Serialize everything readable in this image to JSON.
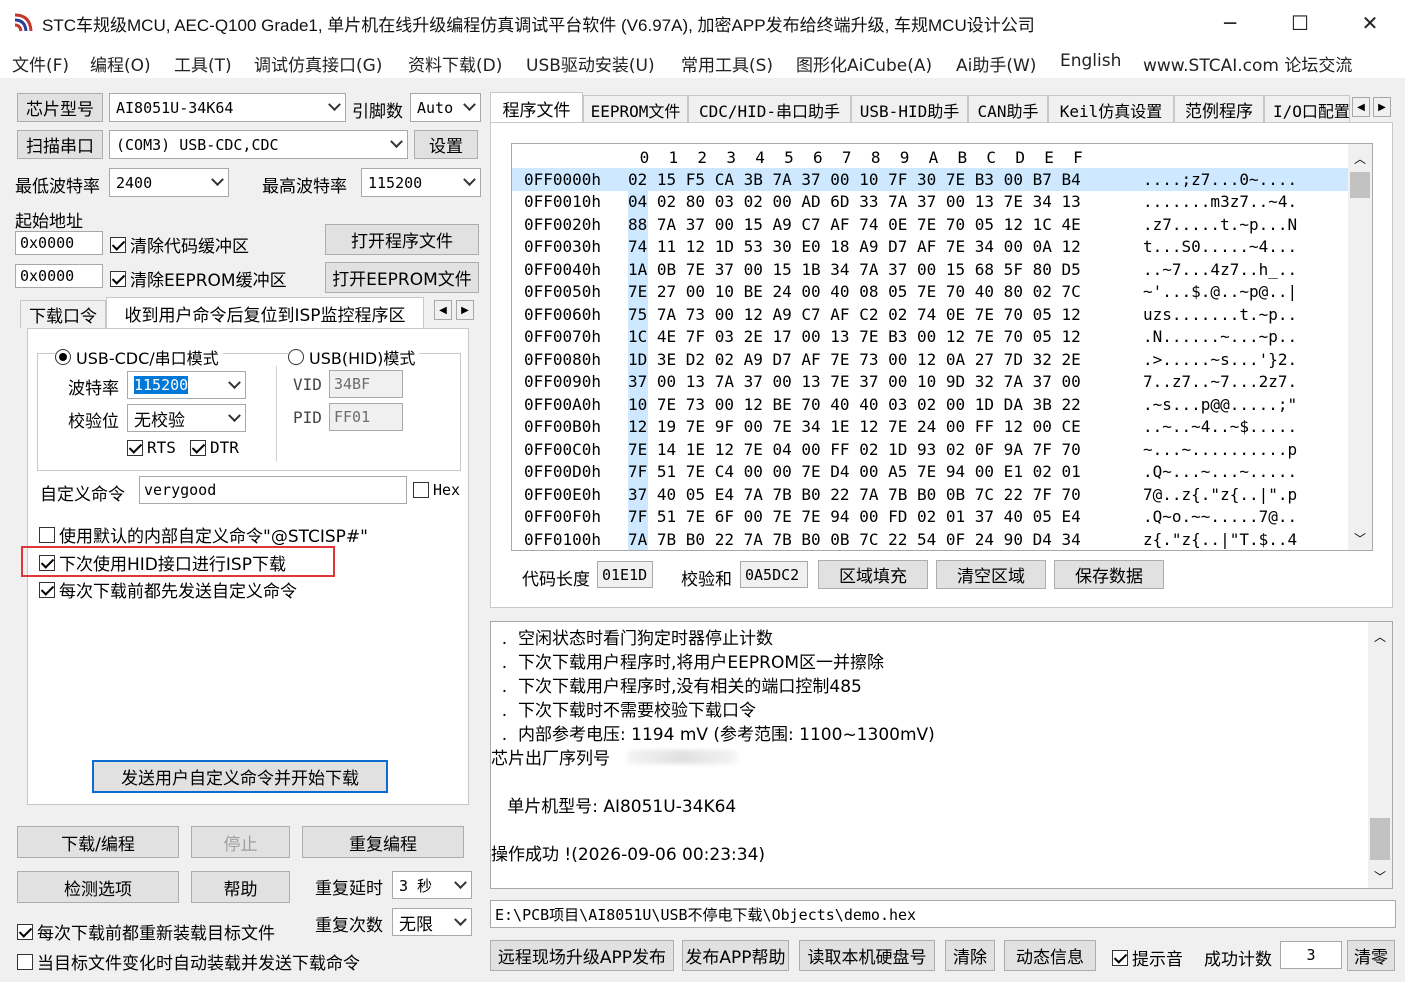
{
  "window": {
    "title": "STC车规级MCU, AEC-Q100 Grade1, 单片机在线升级编程仿真调试平台软件 (V6.97A), 加密APP发布给终端升级, 车规MCU设计公司",
    "minimize": "─",
    "maximize": "☐",
    "close": "✕"
  },
  "menu": [
    "文件(F)",
    "编程(O)",
    "工具(T)",
    "调试仿真接口(G)",
    "资料下载(D)",
    "USB驱动安装(U)",
    "常用工具(S)",
    "图形化AiCube(A)",
    "Ai助手(W)",
    "English",
    "www.STCAI.com 论坛交流"
  ],
  "left": {
    "chip_button": "芯片型号",
    "chip_value": "AI8051U-34K64",
    "pins_label": "引脚数",
    "pins_value": "Auto",
    "scan_button": "扫描串口",
    "port_value": "(COM3) USB-CDC,CDC",
    "settings_button": "设置",
    "min_baud_label": "最低波特率",
    "min_baud_value": "2400",
    "max_baud_label": "最高波特率",
    "max_baud_value": "115200",
    "start_addr_label": "起始地址",
    "code_addr": "0x0000",
    "clear_code_label": "清除代码缓冲区",
    "open_program_button": "打开程序文件",
    "eeprom_addr": "0x0000",
    "clear_eeprom_label": "清除EEPROM缓冲区",
    "open_eeprom_button": "打开EEPROM文件",
    "subtabs": [
      "下载口令",
      "收到用户命令后复位到ISP监控程序区"
    ],
    "cdc_mode_label": "USB-CDC/串口模式",
    "hid_mode_label": "USB(HID)模式",
    "baud_label": "波特率",
    "baud_value": "115200",
    "parity_label": "校验位",
    "parity_value": "无校验",
    "rts_label": "RTS",
    "dtr_label": "DTR",
    "vid_label": "VID",
    "vid_value": "34BF",
    "pid_label": "PID",
    "pid_value": "FF01",
    "custom_cmd_label": "自定义命令",
    "custom_cmd_value": "verygood",
    "hex_label": "Hex",
    "default_cmd_label": "使用默认的内部自定义命令\"@STCISP#\"",
    "next_hid_label": "下次使用HID接口进行ISP下载",
    "send_before_label": "每次下载前都先发送自定义命令",
    "send_start_button": "发送用户自定义命令并开始下载",
    "download_button": "下载/编程",
    "stop_button": "停止",
    "reprogram_button": "重复编程",
    "options_button": "检测选项",
    "help_button": "帮助",
    "repeat_delay_label": "重复延时",
    "repeat_delay_value": "3 秒",
    "repeat_count_label": "重复次数",
    "repeat_count_value": "无限",
    "reload_label": "每次下载前都重新装载目标文件",
    "auto_load_label": "当目标文件变化时自动装载并发送下载命令"
  },
  "right": {
    "tabs": [
      "程序文件",
      "EEPROM文件",
      "CDC/HID-串口助手",
      "USB-HID助手",
      "CAN助手",
      "Keil仿真设置",
      "范例程序",
      "I/O口配置"
    ],
    "hex_header": [
      "0",
      "1",
      "2",
      "3",
      "4",
      "5",
      "6",
      "7",
      "8",
      "9",
      "A",
      "B",
      "C",
      "D",
      "E",
      "F"
    ],
    "hex_rows": [
      {
        "addr": "0FF0000h",
        "bytes": "02 15 F5 CA 3B 7A 37 00 10 7F 30 7E B3 00 B7 B4",
        "ascii": "....;z7...0~...."
      },
      {
        "addr": "0FF0010h",
        "bytes": "04 02 80 03 02 00 AD 6D 33 7A 37 00 13 7E 34 13",
        "ascii": ".......m3z7..~4."
      },
      {
        "addr": "0FF0020h",
        "bytes": "88 7A 37 00 15 A9 C7 AF 74 0E 7E 70 05 12 1C 4E",
        "ascii": ".z7.....t.~p...N"
      },
      {
        "addr": "0FF0030h",
        "bytes": "74 11 12 1D 53 30 E0 18 A9 D7 AF 7E 34 00 0A 12",
        "ascii": "t...S0.....~4..."
      },
      {
        "addr": "0FF0040h",
        "bytes": "1A 0B 7E 37 00 15 1B 34 7A 37 00 15 68 5F 80 D5",
        "ascii": "..~7...4z7..h_.."
      },
      {
        "addr": "0FF0050h",
        "bytes": "7E 27 00 10 BE 24 00 40 08 05 7E 70 40 80 02 7C",
        "ascii": "~'...$.@..~p@..|"
      },
      {
        "addr": "0FF0060h",
        "bytes": "75 7A 73 00 12 A9 C7 AF C2 02 74 0E 7E 70 05 12",
        "ascii": "uzs.......t.~p.."
      },
      {
        "addr": "0FF0070h",
        "bytes": "1C 4E 7F 03 2E 17 00 13 7E B3 00 12 7E 70 05 12",
        "ascii": ".N......~...~p.."
      },
      {
        "addr": "0FF0080h",
        "bytes": "1D 3E D2 02 A9 D7 AF 7E 73 00 12 0A 27 7D 32 2E",
        "ascii": ".>.....~s...'}2."
      },
      {
        "addr": "0FF0090h",
        "bytes": "37 00 13 7A 37 00 13 7E 37 00 10 9D 32 7A 37 00",
        "ascii": "7..z7..~7...2z7."
      },
      {
        "addr": "0FF00A0h",
        "bytes": "10 7E 73 00 12 BE 70 40 40 03 02 00 1D DA 3B 22",
        "ascii": ".~s...p@@.....;\""
      },
      {
        "addr": "0FF00B0h",
        "bytes": "12 19 7E 9F 00 7E 34 1E 12 7E 24 00 FF 12 00 CE",
        "ascii": "..~..~4..~$....."
      },
      {
        "addr": "0FF00C0h",
        "bytes": "7E 14 1E 12 7E 04 00 FF 02 1D 93 02 0F 9A 7F 70",
        "ascii": "~...~..........p"
      },
      {
        "addr": "0FF00D0h",
        "bytes": "7F 51 7E C4 00 00 7E D4 00 A5 7E 94 00 E1 02 01",
        "ascii": ".Q~...~...~....."
      },
      {
        "addr": "0FF00E0h",
        "bytes": "37 40 05 E4 7A 7B B0 22 7A 7B B0 0B 7C 22 7F 70",
        "ascii": "7@..z{.\"z{..|\".p"
      },
      {
        "addr": "0FF00F0h",
        "bytes": "7F 51 7E 6F 00 7E 7E 94 00 FD 02 01 37 40 05 E4",
        "ascii": ".Q~o.~~.....7@.."
      },
      {
        "addr": "0FF0100h",
        "bytes": "7A 7B B0 22 7A 7B B0 0B 7C 22 54 0F 24 90 D4 34",
        "ascii": "z{.\"z{..|\"T.$..4"
      }
    ],
    "code_len_label": "代码长度",
    "code_len_value": "01E1D",
    "checksum_label": "校验和",
    "checksum_value": "0A5DC2",
    "fill_button": "区域填充",
    "clear_area_button": "清空区域",
    "save_button": "保存数据",
    "log_lines": [
      "  .  空闲状态时看门狗定时器停止计数",
      "  .  下次下载用户程序时,将用户EEPROM区一并擦除",
      "  .  下次下载用户程序时,没有相关的端口控制485",
      "  .  下次下载时不需要校验下载口令",
      "  .  内部参考电压: 1194 mV (参考范围: 1100~1300mV)",
      "芯片出厂序列号",
      "",
      "   单片机型号: AI8051U-34K64",
      "",
      "操作成功 !(2026-09-06 00:23:34)"
    ],
    "file_path": "E:\\PCB项目\\AI8051U\\USB不停电下载\\Objects\\demo.hex",
    "remote_button": "远程现场升级APP发布",
    "app_help_button": "发布APP帮助",
    "read_disk_button": "读取本机硬盘号",
    "clear_button": "清除",
    "dynamic_button": "动态信息",
    "sound_label": "提示音",
    "success_label": "成功计数",
    "success_value": "3",
    "reset_count_button": "清零"
  },
  "colors": {
    "highlight_box": "#e0353a",
    "focus_border": "#0a6cd0",
    "selection": "#0078d7",
    "row_selected": "#cde8ff"
  }
}
